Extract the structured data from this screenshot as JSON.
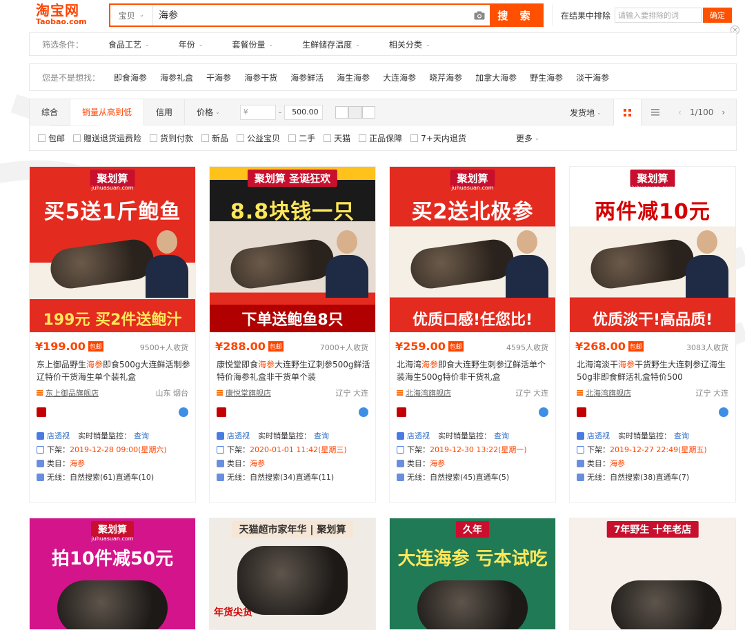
{
  "header": {
    "logo_cn": "淘宝网",
    "logo_en": "Taobao.com",
    "search_category": "宝贝",
    "search_query": "海参",
    "search_button": "搜 索",
    "exclude_label": "在结果中排除",
    "exclude_placeholder": "请输入要排除的词",
    "exclude_button": "确定"
  },
  "filters": {
    "label": "筛选条件：",
    "items": [
      "食品工艺",
      "年份",
      "套餐份量",
      "生鲜储存温度",
      "相关分类"
    ]
  },
  "suggest": {
    "label": "您是不是想找：",
    "items": [
      "即食海参",
      "海参礼盒",
      "干海参",
      "海参干货",
      "海参鲜活",
      "海生海参",
      "大连海参",
      "晓芹海参",
      "加拿大海参",
      "野生海参",
      "淡干海参"
    ]
  },
  "sort": {
    "tabs": [
      "综合",
      "销量从高到低",
      "信用",
      "价格"
    ],
    "price_min": "¥",
    "price_max": "500.00",
    "ship_from": "发货地",
    "page": "1/100"
  },
  "checks": {
    "items": [
      "包邮",
      "赠送退货运费险",
      "货到付款",
      "新品",
      "公益宝贝",
      "二手",
      "天猫",
      "正品保障",
      "7+天内退货"
    ],
    "more": "更多"
  },
  "products": [
    {
      "banner": "聚划算",
      "banner_sub": "juhuasuan.com",
      "headline": "买5送1斤鲍鱼",
      "footer": "199元 买2件送鲍汁",
      "price": "¥199.00",
      "tag": "包邮",
      "sales": "9500+人收货",
      "title_pre": "东上御品野生",
      "title_hl": "海参",
      "title_post": "即食500g大连鲜活制参辽特价干货海生单个装礼盒",
      "shop": "东上御品旗舰店",
      "loc": "山东 烟台",
      "perspective": "店透视",
      "monitor": "实时销量监控：",
      "query": "查询",
      "offshelf_label": "下架：",
      "offshelf": "2019-12-28 09:00(星期六)",
      "cat_label": "类目：",
      "cat": "海参",
      "wireless_label": "无线：",
      "natural": "自然搜索(61)",
      "direct": "直通车(10)"
    },
    {
      "banner": "聚划算 圣诞狂欢",
      "banner_sub": "",
      "headline": "8.8块钱一只",
      "footer": "下单送鲍鱼8只",
      "price": "¥288.00",
      "tag": "包邮",
      "sales": "7000+人收货",
      "title_pre": "康悦堂即食",
      "title_hl": "海参",
      "title_post": "大连野生辽刺参500g鲜活特价海参礼盒非干货单个装",
      "shop": "康悦堂旗舰店",
      "loc": "辽宁 大连",
      "perspective": "店透视",
      "monitor": "实时销量监控：",
      "query": "查询",
      "offshelf_label": "下架：",
      "offshelf": "2020-01-01 11:42(星期三)",
      "cat_label": "类目：",
      "cat": "海参",
      "wireless_label": "无线：",
      "natural": "自然搜索(34)",
      "direct": "直通车(11)"
    },
    {
      "banner": "聚划算",
      "banner_sub": "juhuasuan.com",
      "headline": "买2送北极参",
      "footer": "优质口感!任您比!",
      "price": "¥259.00",
      "tag": "包邮",
      "sales": "4595人收货",
      "title_pre": "北海湾",
      "title_hl": "海参",
      "title_post": "即食大连野生刺参辽鲜活单个装海生500g特价非干货礼盒",
      "shop": "北海湾旗舰店",
      "loc": "辽宁 大连",
      "perspective": "店透视",
      "monitor": "实时销量监控：",
      "query": "查询",
      "offshelf_label": "下架：",
      "offshelf": "2019-12-30 13:22(星期一)",
      "cat_label": "类目：",
      "cat": "海参",
      "wireless_label": "无线：",
      "natural": "自然搜索(45)",
      "direct": "直通车(5)"
    },
    {
      "banner": "聚划算",
      "banner_sub": "juhuasuan.com",
      "headline": "两件减10元",
      "footer": "优质淡干!高品质!",
      "price": "¥268.00",
      "tag": "包邮",
      "sales": "3083人收货",
      "title_pre": "北海湾淡干",
      "title_hl": "海参",
      "title_post": "干货野生大连刺参辽海生50g非即食鲜活礼盒特价500",
      "shop": "北海湾旗舰店",
      "loc": "辽宁 大连",
      "perspective": "店透视",
      "monitor": "实时销量监控：",
      "query": "查询",
      "offshelf_label": "下架：",
      "offshelf": "2019-12-27 22:49(星期五)",
      "cat_label": "类目：",
      "cat": "海参",
      "wireless_label": "无线：",
      "natural": "自然搜索(38)",
      "direct": "直通车(7)"
    }
  ],
  "products_row2": [
    {
      "banner": "聚划算",
      "banner_sub": "juhuasuan.com",
      "headline": "拍10件减50元",
      "bg": "#d4148a"
    },
    {
      "banner": "天猫超市家年华 | 聚划算",
      "banner_sub": "",
      "headline": "年货尖货",
      "bg": "#f0ebe4"
    },
    {
      "banner": "久年",
      "banner_sub": "",
      "headline": "大连海参 亏本试吃",
      "bg": "#1f7a55"
    },
    {
      "banner": "7年野生 十年老店",
      "banner_sub": "",
      "headline": "",
      "bg": "#f7f0ea"
    }
  ]
}
